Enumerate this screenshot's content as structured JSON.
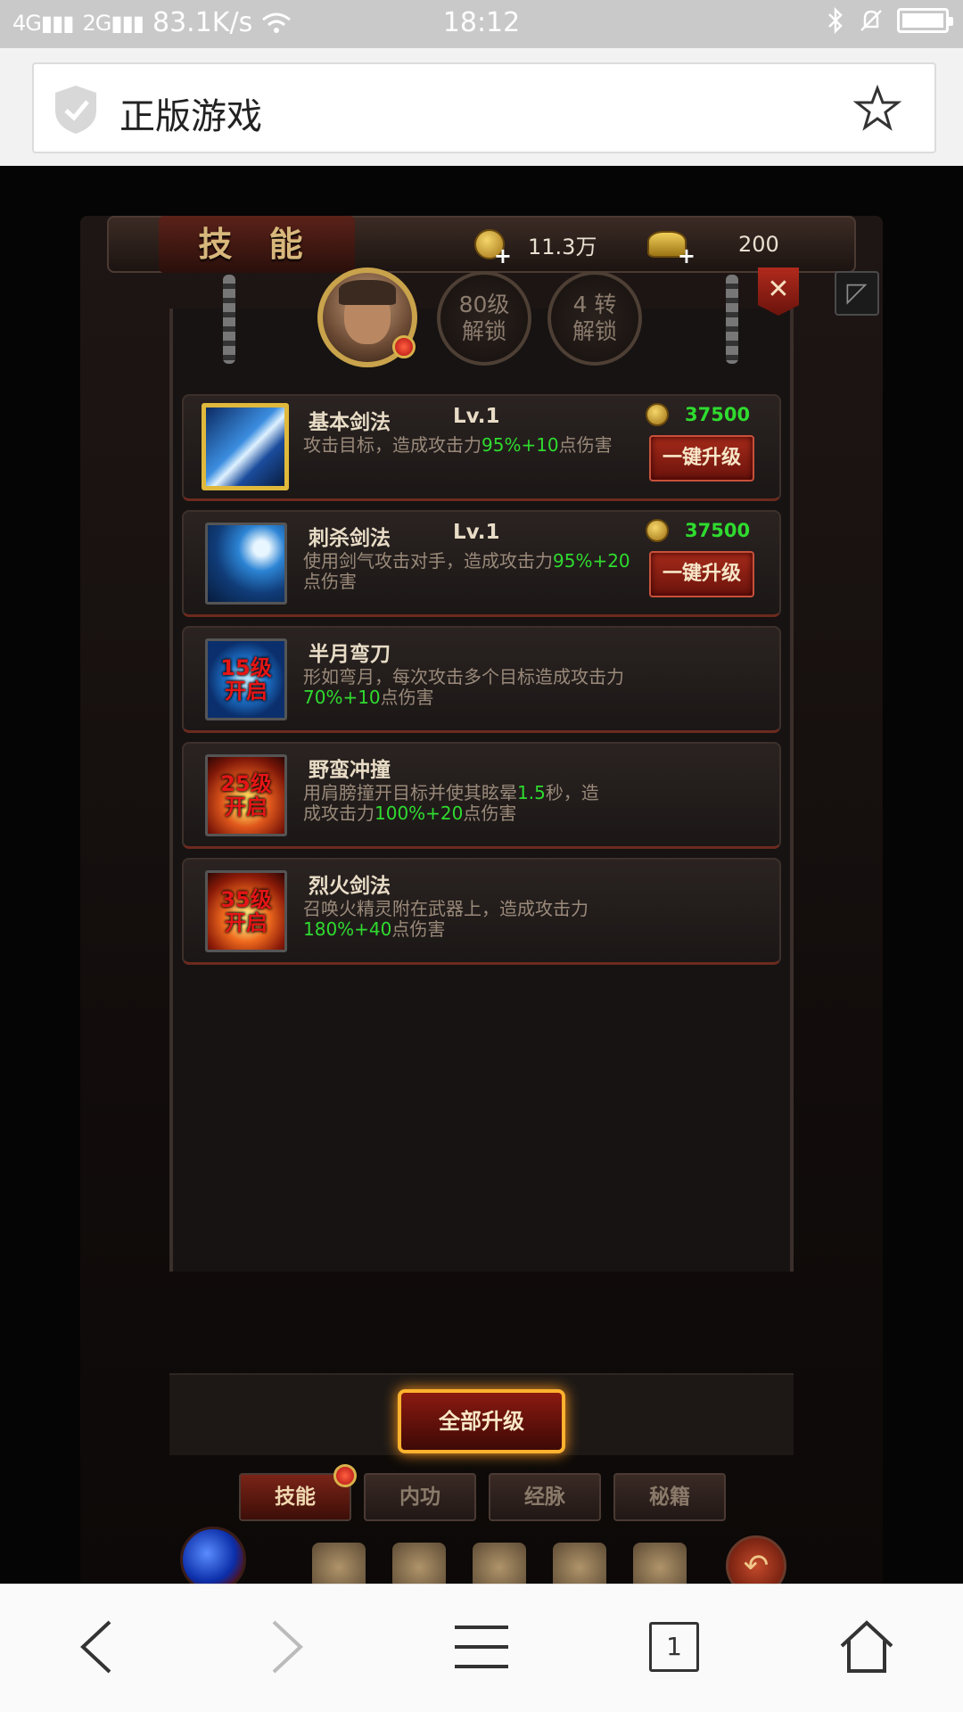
{
  "status_bar": {
    "net1": "4G",
    "net2": "2G",
    "speed": "83.1K/s",
    "time": "18:12"
  },
  "browser": {
    "page_title": "正版游戏",
    "tab_count": "1"
  },
  "game": {
    "panel_title": "技 能",
    "coins": "11.3万",
    "ingots": "200",
    "lock1": {
      "line1": "80级",
      "line2": "解锁"
    },
    "lock2": {
      "line1": "4 转",
      "line2": "解锁"
    },
    "close_label": "✕",
    "skills": [
      {
        "name": "基本剑法",
        "level": "Lv.1",
        "cost": "37500",
        "desc_pre": "攻击目标，造成攻击力",
        "desc_hl": "95%+10",
        "desc_post": "点伤害",
        "button": "一键升级"
      },
      {
        "name": "刺杀剑法",
        "level": "Lv.1",
        "cost": "37500",
        "desc_pre": "使用剑气攻击对手，造成攻击力",
        "desc_hl": "95%+20",
        "desc_post": "点伤害",
        "button": "一键升级"
      },
      {
        "name": "半月弯刀",
        "lock_line1": "15级",
        "lock_line2": "开启",
        "desc_pre": "形如弯月，每次攻击多个目标造成攻击力",
        "desc_hl": "70%+10",
        "desc_post": "点伤害"
      },
      {
        "name": "野蛮冲撞",
        "lock_line1": "25级",
        "lock_line2": "开启",
        "desc_pre": "用肩膀撞开目标并使其眩晕",
        "desc_hl": "1.5",
        "desc_mid": "秒，造成攻击力",
        "desc_hl2": "100%+20",
        "desc_post": "点伤害"
      },
      {
        "name": "烈火剑法",
        "lock_line1": "35级",
        "lock_line2": "开启",
        "desc_pre": "召唤火精灵附在武器上，造成攻击力",
        "desc_hl": "180%+40",
        "desc_post": "点伤害"
      }
    ],
    "upgrade_all": "全部升级",
    "tabs": [
      "技能",
      "内功",
      "经脉",
      "秘籍"
    ]
  }
}
